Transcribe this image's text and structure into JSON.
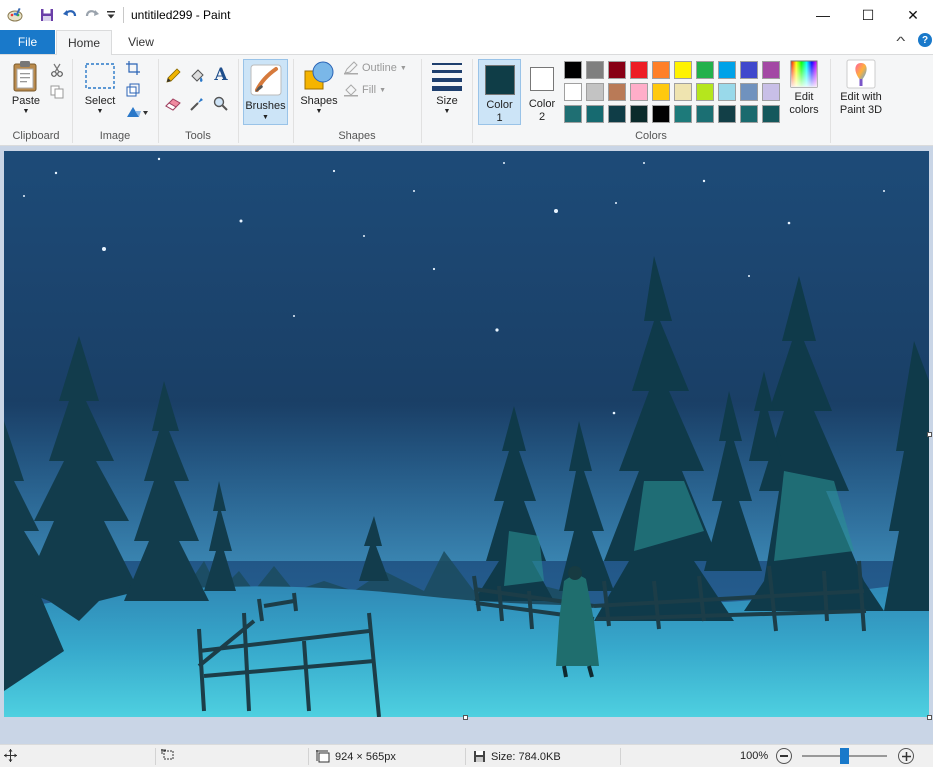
{
  "window": {
    "title": "untitiled299 - Paint",
    "minimize_glyph": "—",
    "maximize_glyph": "☐",
    "close_glyph": "✕"
  },
  "quick_access": {
    "icons": [
      "paint-app-icon",
      "save-icon",
      "undo-icon",
      "redo-icon",
      "customize-dropdown-icon"
    ]
  },
  "tabs": {
    "file": "File",
    "home": "Home",
    "view": "View",
    "collapse_glyph": "^",
    "help_glyph": "?"
  },
  "ribbon": {
    "clipboard": {
      "paste": "Paste",
      "group": "Clipboard"
    },
    "image": {
      "select": "Select",
      "group": "Image"
    },
    "tools": {
      "group": "Tools"
    },
    "brushes": {
      "label": "Brushes"
    },
    "shapes": {
      "label": "Shapes",
      "outline": "Outline",
      "fill": "Fill",
      "group": "Shapes"
    },
    "size": {
      "label": "Size"
    },
    "colors": {
      "color1_label": "Color",
      "color1_num": "1",
      "color2_label": "Color",
      "color2_num": "2",
      "color1_value": "#0f3d47",
      "color2_value": "#ffffff",
      "edit_colors_line1": "Edit",
      "edit_colors_line2": "colors",
      "group": "Colors",
      "palette_row1": [
        "#000000",
        "#7f7f7f",
        "#880015",
        "#ed1c24",
        "#ff7f27",
        "#fff200",
        "#22b14c",
        "#00a2e8",
        "#3f48cc",
        "#a349a4"
      ],
      "palette_row2": [
        "#ffffff",
        "#c3c3c3",
        "#b97a57",
        "#ffaec9",
        "#ffc90e",
        "#efe4b0",
        "#b5e61d",
        "#99d9ea",
        "#7092be",
        "#c8bfe7"
      ],
      "palette_row3": [
        "#1f6f73",
        "#166a70",
        "#0f3d47",
        "#0b2b2b",
        "#000000",
        "#1d7a7a",
        "#1b6f73",
        "#123f47",
        "#1a6a6e",
        "#14585c"
      ]
    },
    "paint3d": {
      "line1": "Edit with",
      "line2": "Paint 3D"
    }
  },
  "status": {
    "dimensions": "924 × 565px",
    "size": "Size: 784.0KB",
    "zoom": "100%",
    "zoom_level": 0.5
  }
}
